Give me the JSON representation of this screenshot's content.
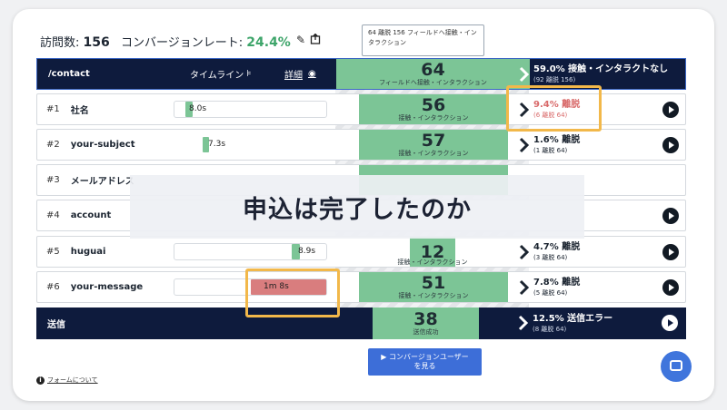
{
  "header": {
    "visits_label": "訪問数:",
    "visits_value": "156",
    "conversion_label": "コンバージョンレート:",
    "conversion_value": "24.4%",
    "edit_icon": "pencil-icon",
    "export_icon": "export-icon"
  },
  "tooltip": {
    "line1": "64 離脱 156 フィールドへ接触・イン",
    "line2": "タラクション"
  },
  "page_row": {
    "path": "/contact",
    "timeline_label": "タイムライン",
    "detail_label": "詳細",
    "count": "64",
    "count_label": "フィールドへ接触・インタラクション",
    "right_main": "59.0% 接触・インタラクトなし",
    "right_small": "(92 離脱 156)"
  },
  "fields": [
    {
      "index": "#1",
      "name": "社名",
      "time": "8.0s",
      "count": "56",
      "count_label": "接触・インタラクション",
      "drop_main": "9.4% 離脱",
      "drop_small": "(6 離脱 64)"
    },
    {
      "index": "#2",
      "name": "your-subject",
      "time": "7.3s",
      "count": "57",
      "count_label": "接触・インタラクション",
      "drop_main": "1.6% 離脱",
      "drop_small": "(1 離脱 64)"
    },
    {
      "index": "#3",
      "name": "メールアドレス",
      "time": "",
      "count": "",
      "count_label": "",
      "drop_main": "",
      "drop_small": ""
    },
    {
      "index": "#4",
      "name": "account",
      "time": "",
      "count": "",
      "count_label": "",
      "drop_main": "",
      "drop_small": ""
    },
    {
      "index": "#5",
      "name": "huguai",
      "time": "8.9s",
      "count": "12",
      "count_label": "接触・インタラクション",
      "drop_main": "4.7% 離脱",
      "drop_small": "(3 離脱 64)"
    },
    {
      "index": "#6",
      "name": "your-message",
      "time": "1m 8s",
      "count": "51",
      "count_label": "接触・インタラクション",
      "drop_main": "7.8% 離脱",
      "drop_small": "(5 離脱 64)"
    }
  ],
  "submit_row": {
    "label": "送信",
    "count": "38",
    "count_label": "送信成功",
    "right_main": "12.5% 送信エラー",
    "right_small": "(8 離脱 64)"
  },
  "overlay_caption": "申込は完了したのか",
  "cta": {
    "line1": "コンバージョンユーザー",
    "line2": "を見る"
  },
  "footer": {
    "about_link": "フォームについて"
  },
  "colors": {
    "navy": "#0e1b3d",
    "green": "#7cc596",
    "red": "#d96a6a",
    "highlight": "#f2b84a",
    "blue": "#3d6ed8"
  }
}
